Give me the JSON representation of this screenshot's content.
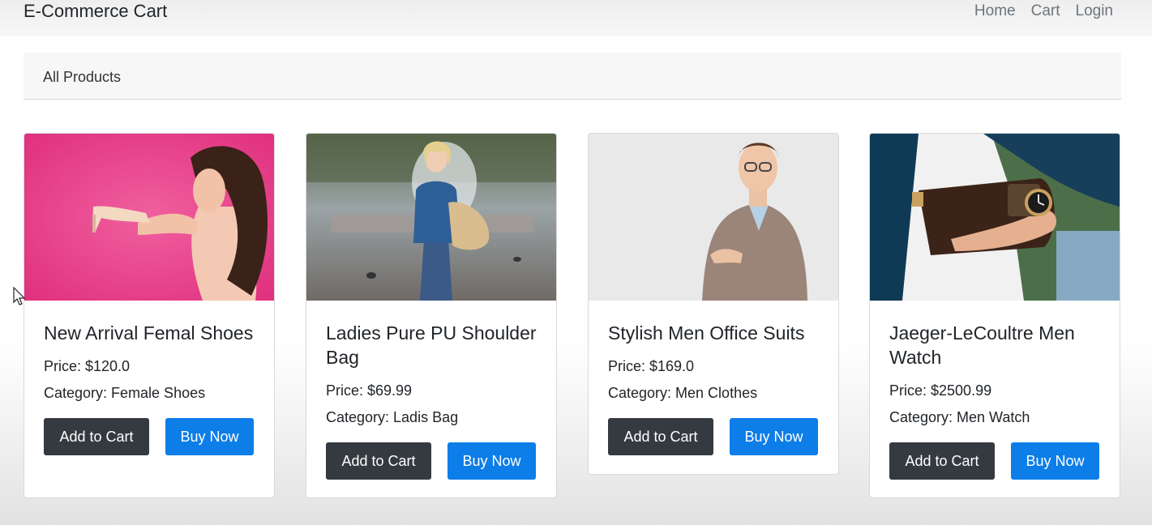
{
  "navbar": {
    "brand": "E-Commerce Cart",
    "links": [
      "Home",
      "Cart",
      "Login"
    ]
  },
  "breadcrumb": {
    "label": "All Products"
  },
  "products": [
    {
      "title": "New Arrival Femal Shoes",
      "price": "Price: $120.0",
      "category": "Category: Female Shoes",
      "add_to_cart": "Add to Cart",
      "buy_now": "Buy Now",
      "image": "woman-holding-shoe-image"
    },
    {
      "title": "Ladies Pure PU Shoulder Bag",
      "price": "Price: $69.99",
      "category": "Category: Ladis Bag",
      "add_to_cart": "Add to Cart",
      "buy_now": "Buy Now",
      "image": "woman-with-shoulder-bag-image"
    },
    {
      "title": "Stylish Men Office Suits",
      "price": "Price: $169.0",
      "category": "Category: Men Clothes",
      "add_to_cart": "Add to Cart",
      "buy_now": "Buy Now",
      "image": "man-in-suit-image"
    },
    {
      "title": "Jaeger-LeCoultre Men Watch",
      "price": "Price: $2500.99",
      "category": "Category: Men Watch",
      "add_to_cart": "Add to Cart",
      "buy_now": "Buy Now",
      "image": "man-wrist-watch-image"
    }
  ],
  "colors": {
    "btn_dark": "#343a40",
    "btn_primary": "#0d7de8",
    "navbar_link": "#6c757d"
  }
}
